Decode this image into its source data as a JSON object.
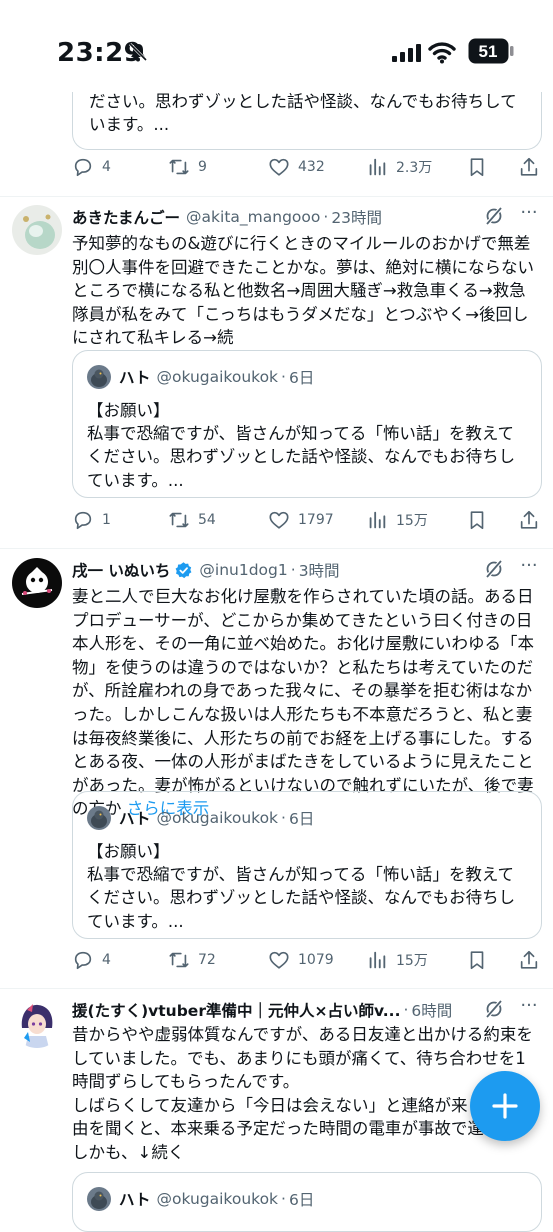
{
  "status": {
    "time": "23:29",
    "battery": "51"
  },
  "top_quote": {
    "text": "ださい。思わずゾッとした話や怪談、なんでもお待ちしています。..."
  },
  "top_actions": {
    "replies": "4",
    "reposts": "9",
    "likes": "432",
    "views": "2.3万"
  },
  "tweets": [
    {
      "name": "あきたまんごー",
      "handle": "@akita_mangooo",
      "time": "23時間",
      "verified": false,
      "body": "予知夢的なもの&遊びに行くときのマイルールのおかげで無差別〇人事件を回避できたことかな。夢は、絶対に横にならないところで横になる私と他数名→周囲大騒ぎ→救急車くる→救急隊員が私をみて「こっちはもうダメだな」とつぶやく→後回しにされて私キレる→続",
      "more": "",
      "quote": {
        "name": "ハト",
        "handle": "@okugaikoukok",
        "time": "6日",
        "body": "【お願い】\n私事で恐縮ですが、皆さんが知ってる「怖い話」を教えてください。思わずゾッとした話や怪談、なんでもお待ちしています。..."
      },
      "actions": {
        "replies": "1",
        "reposts": "54",
        "likes": "1797",
        "views": "15万"
      }
    },
    {
      "name": "戌一 いぬいち",
      "handle": "@inu1dog1",
      "time": "3時間",
      "verified": true,
      "body": "妻と二人で巨大なお化け屋敷を作らされていた頃の話。ある日プロデューサーが、どこからか集めてきたという曰く付きの日本人形を、その一角に並べ始めた。お化け屋敷にいわゆる「本物」を使うのは違うのではないか？と私たちは考えていたのだが、所詮雇われの身であった我々に、その暴挙を拒む術はなかった。しかしこんな扱いは人形たちも不本意だろうと、私と妻は毎夜終業後に、人形たちの前でお経を上げる事にした。するとある夜、一体の人形がまばたきをしているように見えたことがあった。妻が怖がるといけないので触れずにいたが、後で妻の方か",
      "more": "さらに表示",
      "quote": {
        "name": "ハト",
        "handle": "@okugaikoukok",
        "time": "6日",
        "body": "【お願い】\n私事で恐縮ですが、皆さんが知ってる「怖い話」を教えてください。思わずゾッとした話や怪談、なんでもお待ちしています。..."
      },
      "actions": {
        "replies": "4",
        "reposts": "72",
        "likes": "1079",
        "views": "15万"
      }
    },
    {
      "name": "援(たすく)vtuber準備中｜元仲人×占い師v...",
      "handle": "",
      "time": "6時間",
      "verified": false,
      "body": "昔からやや虚弱体質なんですが、ある日友達と出かける約束をしていました。でも、あまりにも頭が痛くて、待ち合わせを1時間ずらしてもらったんです。\nしばらくして友達から「今日は会えない」と連絡が来ま\n由を聞くと、本来乗る予定だった時間の電車が事故で運\nしかも、↓続く",
      "more": "",
      "quote": {
        "name": "ハト",
        "handle": "@okugaikoukok",
        "time": "6日"
      }
    }
  ],
  "icons": [
    "bell-slash-icon",
    "signal-icon",
    "wifi-icon",
    "battery-icon",
    "reply-icon",
    "repost-icon",
    "like-icon",
    "views-icon",
    "bookmark-icon",
    "share-icon",
    "grok-icon",
    "more-icon",
    "verified-badge-icon",
    "compose-plus-icon"
  ],
  "colors": {
    "accent": "#1d9bf0",
    "text": "#0f1419",
    "muted": "#536471",
    "border": "#cfd9de"
  }
}
